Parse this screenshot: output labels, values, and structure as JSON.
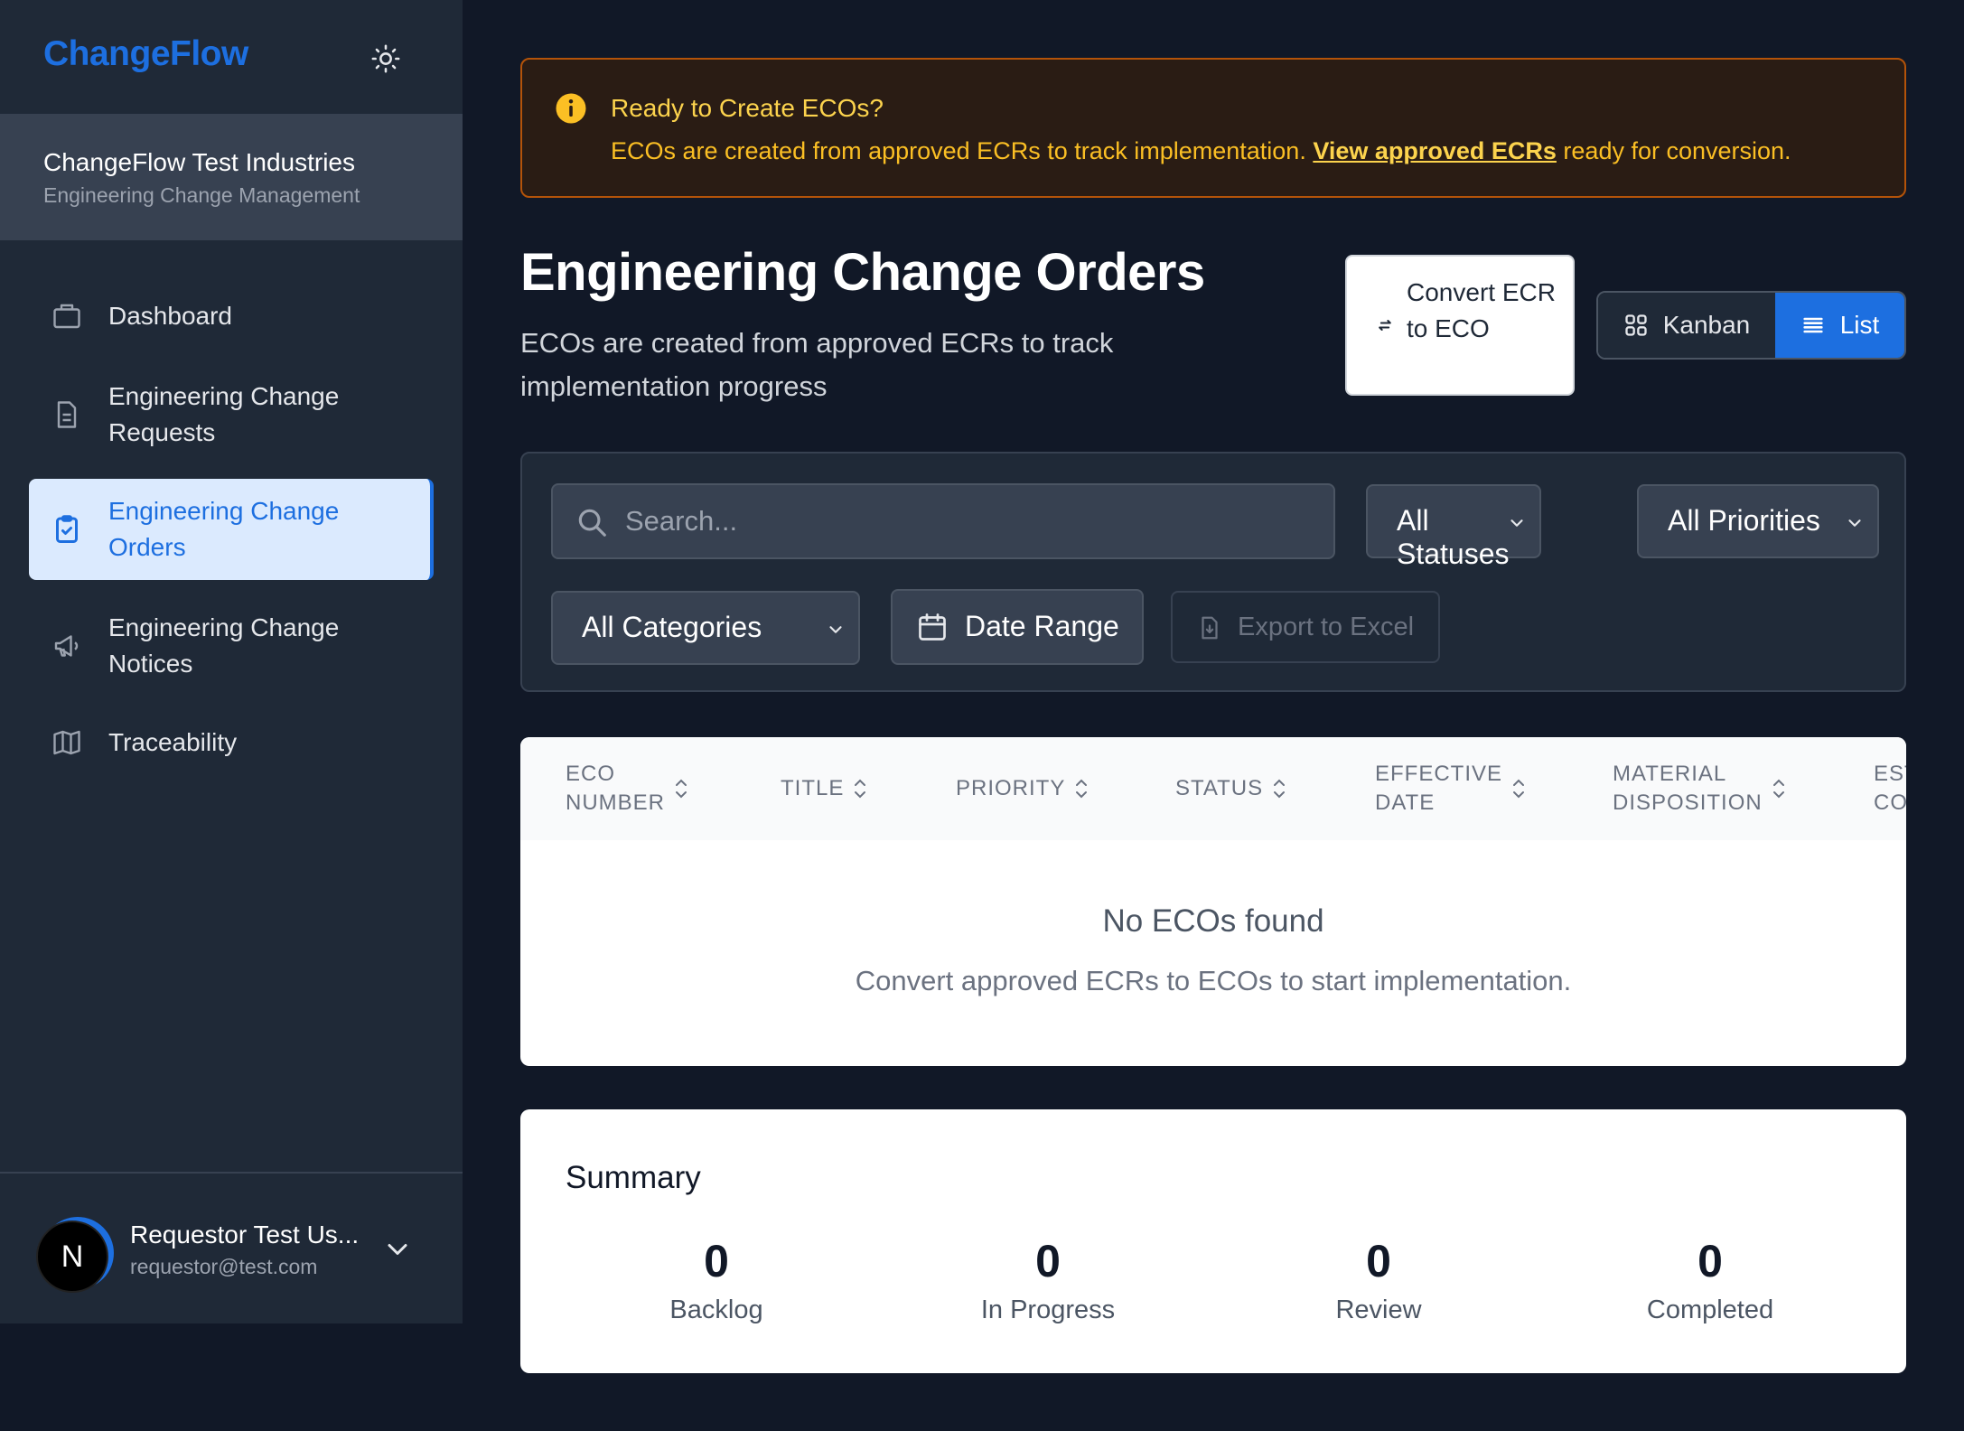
{
  "app": {
    "brand": "ChangeFlow"
  },
  "org": {
    "name": "ChangeFlow Test Industries",
    "subtitle": "Engineering Change Management"
  },
  "nav": {
    "items": [
      {
        "label": "Dashboard",
        "icon": "briefcase-icon"
      },
      {
        "label": "Engineering Change\nRequests",
        "icon": "document-icon"
      },
      {
        "label": "Engineering Change\nOrders",
        "icon": "clipboard-check-icon",
        "active": true
      },
      {
        "label": "Engineering Change\nNotices",
        "icon": "megaphone-icon"
      },
      {
        "label": "Traceability",
        "icon": "map-icon"
      }
    ]
  },
  "user": {
    "initial": "N",
    "name": "Requestor Test Us...",
    "email": "requestor@test.com"
  },
  "banner": {
    "title": "Ready to Create ECOs?",
    "text_before": "ECOs are created from approved ECRs to track implementation. ",
    "link": "View approved ECRs",
    "text_after": " ready for conversion."
  },
  "page": {
    "title": "Engineering Change Orders",
    "subtitle": "ECOs are created from approved ECRs to track implementation progress"
  },
  "actions": {
    "convert_label": "Convert ECR to ECO",
    "view_kanban": "Kanban",
    "view_list": "List",
    "active_view": "List"
  },
  "filters": {
    "search_placeholder": "Search...",
    "status": "All Statuses",
    "priority": "All Priorities",
    "category": "All Categories",
    "date_range": "Date Range",
    "export": "Export to Excel"
  },
  "table": {
    "columns": [
      "ECO\nNUMBER",
      "TITLE",
      "PRIORITY",
      "STATUS",
      "EFFECTIVE\nDATE",
      "MATERIAL\nDISPOSITION",
      "EST\nCO"
    ],
    "empty_title": "No ECOs found",
    "empty_message": "Convert approved ECRs to ECOs to start implementation."
  },
  "summary": {
    "title": "Summary",
    "stats": [
      {
        "value": "0",
        "label": "Backlog"
      },
      {
        "value": "0",
        "label": "In Progress"
      },
      {
        "value": "0",
        "label": "Review"
      },
      {
        "value": "0",
        "label": "Completed"
      }
    ]
  },
  "colors": {
    "accent": "#1d6fe0",
    "background": "#111827",
    "sidebar": "#1f2937",
    "banner_text": "#fbbf24",
    "banner_border": "#b45309"
  }
}
